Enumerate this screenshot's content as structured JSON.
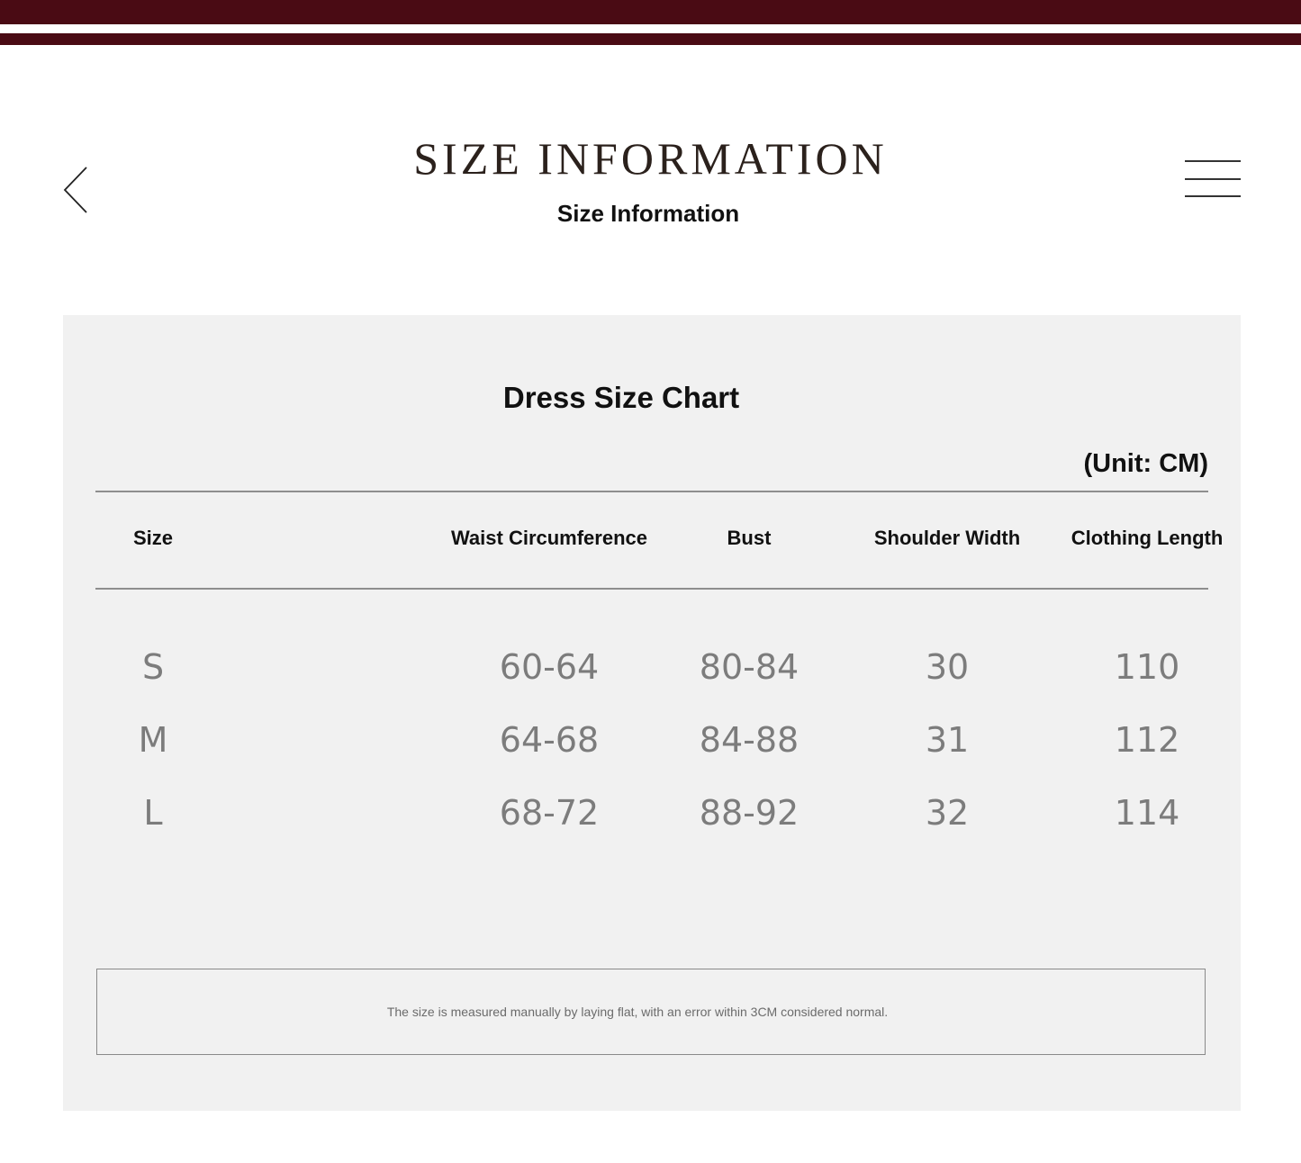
{
  "colors": {
    "stripe": "#4a0b14",
    "panel_background": "#f1f1f1",
    "value_text": "#7c7c7c"
  },
  "header": {
    "back_icon": "chevron-left-icon",
    "menu_icon": "hamburger-menu-icon",
    "title": "SIZE INFORMATION",
    "subtitle": "Size Information"
  },
  "size_chart": {
    "title": "Dress Size Chart",
    "unit": "(Unit: CM)",
    "columns": [
      "Size",
      "Waist Circumference",
      "Bust",
      "Shoulder Width",
      "Clothing Length"
    ],
    "rows": [
      [
        "S",
        "60-64",
        "80-84",
        "30",
        "110"
      ],
      [
        "M",
        "64-68",
        "84-88",
        "31",
        "112"
      ],
      [
        "L",
        "68-72",
        "88-92",
        "32",
        "114"
      ]
    ],
    "note": "The size is measured manually by laying flat, with an error within 3CM considered normal."
  }
}
